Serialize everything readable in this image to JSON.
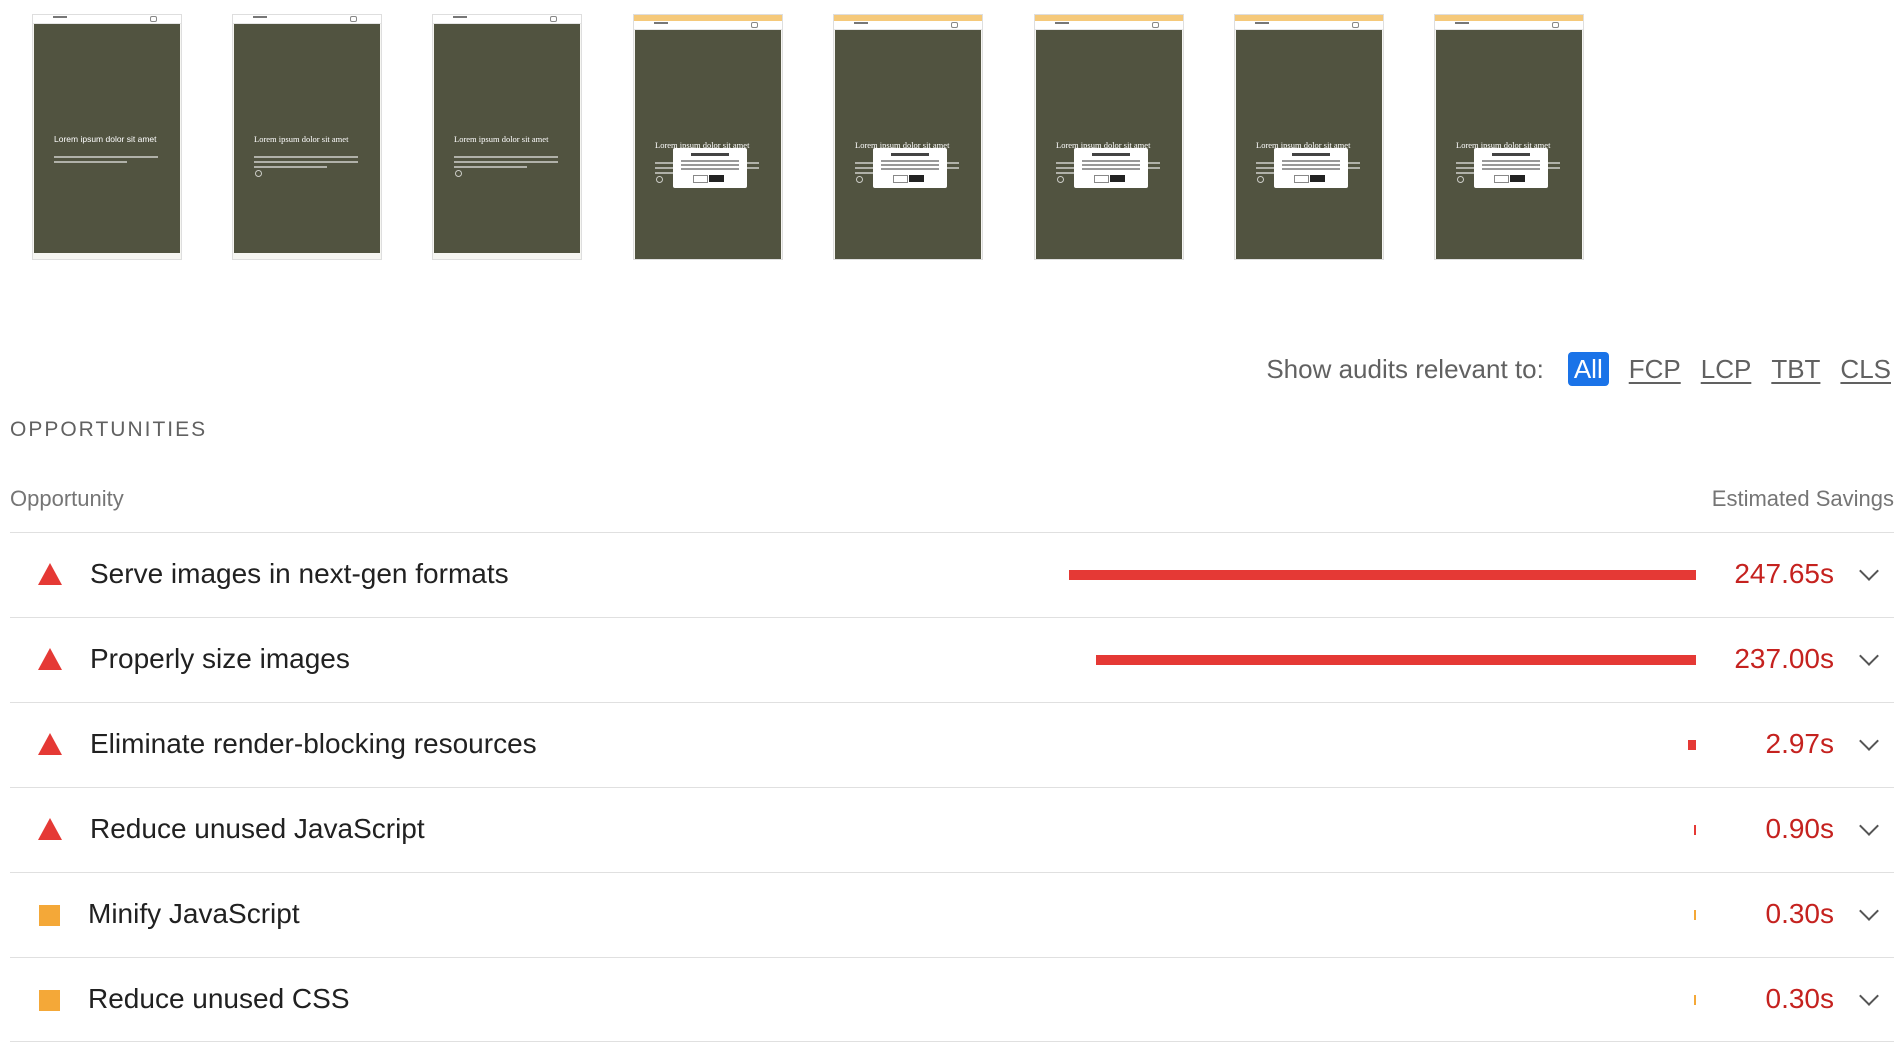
{
  "filmstrip": {
    "frames": [
      {
        "hero_title": "Lorem ipsum dolor sit amet",
        "style": "sans"
      },
      {
        "hero_title": "Lorem ipsum dolor sit amet",
        "style": "serif"
      },
      {
        "hero_title": "Lorem ipsum dolor sit amet",
        "style": "serif"
      },
      {
        "hero_title": "Lorem ipsum dolor sit amet",
        "style": "serif",
        "modal_title": "Lorem Ipsum"
      },
      {
        "hero_title": "Lorem ipsum dolor sit amet",
        "style": "serif",
        "modal_title": "Lorem Ipsum"
      },
      {
        "hero_title": "Lorem ipsum dolor sit amet",
        "style": "serif",
        "modal_title": "Lorem Ipsum"
      },
      {
        "hero_title": "Lorem ipsum dolor sit amet",
        "style": "serif",
        "modal_title": "Lorem Ipsum"
      },
      {
        "hero_title": "Lorem ipsum dolor sit amet",
        "style": "serif",
        "modal_title": "Lorem Ipsum"
      }
    ]
  },
  "filter": {
    "label": "Show audits relevant to:",
    "options": [
      "All",
      "FCP",
      "LCP",
      "TBT",
      "CLS"
    ],
    "selected": "All"
  },
  "section": {
    "title": "OPPORTUNITIES",
    "column_left": "Opportunity",
    "column_right": "Estimated Savings"
  },
  "colors": {
    "fail": "#e53935",
    "average": "#f4a838",
    "savings_text": "#c5221f",
    "active_chip": "#1a73e8"
  },
  "audits": [
    {
      "title": "Serve images in next-gen formats",
      "savings": "247.65s",
      "savings_seconds": 247.65,
      "rating": "fail"
    },
    {
      "title": "Properly size images",
      "savings": "237.00s",
      "savings_seconds": 237.0,
      "rating": "fail"
    },
    {
      "title": "Eliminate render-blocking resources",
      "savings": "2.97s",
      "savings_seconds": 2.97,
      "rating": "fail"
    },
    {
      "title": "Reduce unused JavaScript",
      "savings": "0.90s",
      "savings_seconds": 0.9,
      "rating": "fail"
    },
    {
      "title": "Minify JavaScript",
      "savings": "0.30s",
      "savings_seconds": 0.3,
      "rating": "average"
    },
    {
      "title": "Reduce unused CSS",
      "savings": "0.30s",
      "savings_seconds": 0.3,
      "rating": "average"
    }
  ]
}
